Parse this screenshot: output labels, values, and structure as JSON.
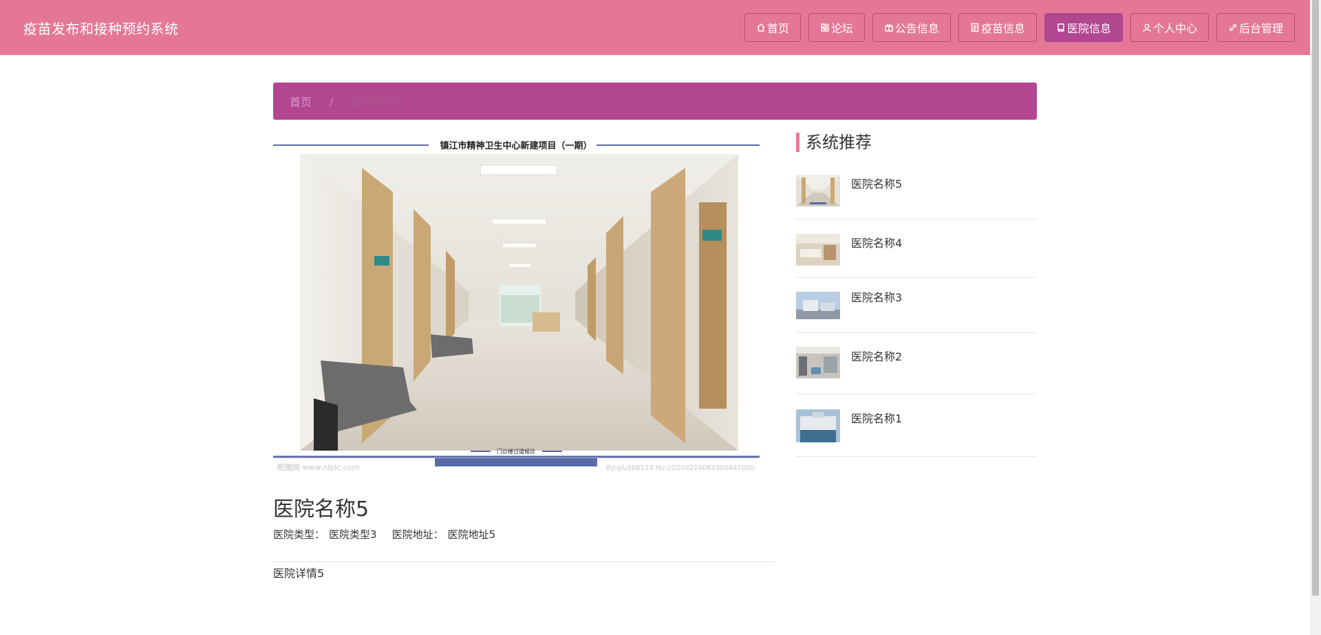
{
  "header": {
    "brand": "疫苗发布和接种预约系统",
    "nav": [
      {
        "label": "首页",
        "icon": "home-icon"
      },
      {
        "label": "论坛",
        "icon": "forum-icon"
      },
      {
        "label": "公告信息",
        "icon": "gift-icon"
      },
      {
        "label": "疫苗信息",
        "icon": "doc-icon"
      },
      {
        "label": "医院信息",
        "icon": "book-icon",
        "active": true
      },
      {
        "label": "个人中心",
        "icon": "user-icon"
      },
      {
        "label": "后台管理",
        "icon": "link-icon"
      }
    ]
  },
  "breadcrumb": {
    "home": "首页",
    "separator": "/",
    "current": "医院名称5"
  },
  "hero": {
    "caption_top": "镇江市精神卫生中心新建项目（一期）",
    "caption_bottom": "门诊楼过道候诊",
    "watermark_left": "昵图网 www.nipic.com",
    "watermark_right": "By:qiu366133 No:20200224083305447000"
  },
  "detail": {
    "title": "医院名称5",
    "type_label": "医院类型：",
    "type_value": "医院类型3",
    "address_label": "医院地址：",
    "address_value": "医院地址5",
    "description": "医院详情5"
  },
  "sidebar": {
    "title": "系统推荐",
    "items": [
      {
        "label": "医院名称5"
      },
      {
        "label": "医院名称4"
      },
      {
        "label": "医院名称3"
      },
      {
        "label": "医院名称2"
      },
      {
        "label": "医院名称1"
      }
    ]
  },
  "colors": {
    "header_bg": "#e57796",
    "accent": "#b24690",
    "sidebar_marker": "#e57796"
  }
}
